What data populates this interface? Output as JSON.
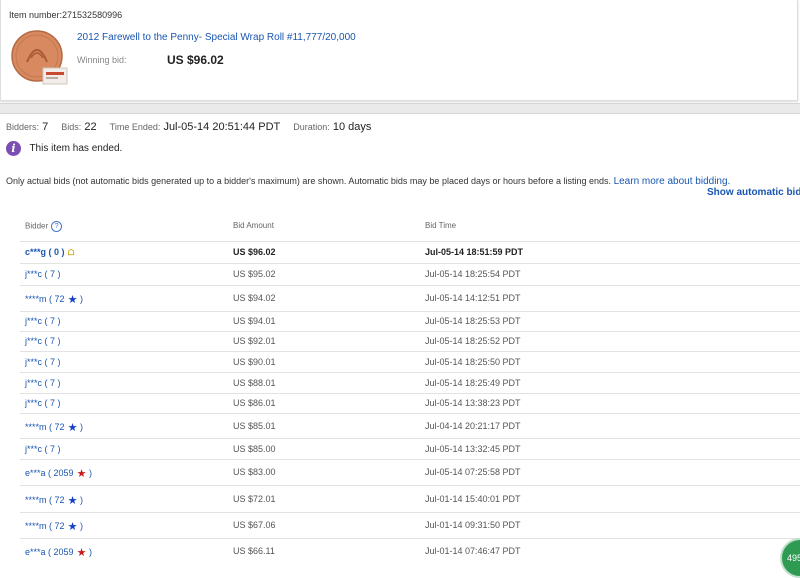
{
  "item": {
    "number_label": "Item number:",
    "number": "271532580996",
    "title": "2012 Farewell to the Penny- Special Wrap Roll #11,777/20,000",
    "winning_bid_label": "Winning bid:",
    "winning_bid": "US $96.02"
  },
  "stats": {
    "bidders_label": "Bidders:",
    "bidders": "7",
    "bids_label": "Bids:",
    "bids": "22",
    "time_ended_label": "Time Ended:",
    "time_ended": "Jul-05-14 20:51:44 PDT",
    "duration_label": "Duration:",
    "duration": "10 days"
  },
  "status": {
    "ended_text": "This item has ended."
  },
  "note": {
    "text": "Only actual bids (not automatic bids generated up to a bidder's maximum) are shown. Automatic bids may be placed days or hours before a listing ends.",
    "link": "Learn more about bidding."
  },
  "show_automatic": "Show automatic bid",
  "table": {
    "headers": {
      "bidder": "Bidder",
      "amount": "Bid Amount",
      "time": "Bid Time"
    },
    "rows": [
      {
        "bidder": "c***g ( 0 )",
        "star": "",
        "amount": "US $96.02",
        "time": "Jul-05-14 18:51:59 PDT"
      },
      {
        "bidder": "j***c ( 7 )",
        "star": "",
        "amount": "US $95.02",
        "time": "Jul-05-14 18:25:54 PDT"
      },
      {
        "bidder": "****m ( 72",
        "star": "blue",
        "amount": "US $94.02",
        "time": "Jul-05-14 14:12:51 PDT"
      },
      {
        "bidder": "j***c ( 7 )",
        "star": "",
        "amount": "US $94.01",
        "time": "Jul-05-14 18:25:53 PDT"
      },
      {
        "bidder": "j***c ( 7 )",
        "star": "",
        "amount": "US $92.01",
        "time": "Jul-05-14 18:25:52 PDT"
      },
      {
        "bidder": "j***c ( 7 )",
        "star": "",
        "amount": "US $90.01",
        "time": "Jul-05-14 18:25:50 PDT"
      },
      {
        "bidder": "j***c ( 7 )",
        "star": "",
        "amount": "US $88.01",
        "time": "Jul-05-14 18:25:49 PDT"
      },
      {
        "bidder": "j***c ( 7 )",
        "star": "",
        "amount": "US $86.01",
        "time": "Jul-05-14 13:38:23 PDT"
      },
      {
        "bidder": "****m ( 72",
        "star": "blue",
        "amount": "US $85.01",
        "time": "Jul-04-14 20:21:17 PDT"
      },
      {
        "bidder": "j***c ( 7 )",
        "star": "",
        "amount": "US $85.00",
        "time": "Jul-05-14 13:32:45 PDT"
      },
      {
        "bidder": "e***a ( 2059",
        "star": "red",
        "amount": "US $83.00",
        "time": "Jul-05-14 07:25:58 PDT"
      },
      {
        "bidder": "****m ( 72",
        "star": "blue",
        "amount": "US $72.01",
        "time": "Jul-01-14 15:40:01 PDT"
      },
      {
        "bidder": "****m ( 72",
        "star": "blue",
        "amount": "US $67.06",
        "time": "Jul-01-14 09:31:50 PDT"
      },
      {
        "bidder": "e***a ( 2059",
        "star": "red",
        "amount": "US $66.11",
        "time": "Jul-01-14 07:46:47 PDT"
      }
    ]
  },
  "chat_bubble": "495",
  "colors": {
    "link": "#1a56b0",
    "info_icon": "#7b4eb2",
    "star_blue": "#1240c8",
    "star_red": "#c81c1c"
  }
}
